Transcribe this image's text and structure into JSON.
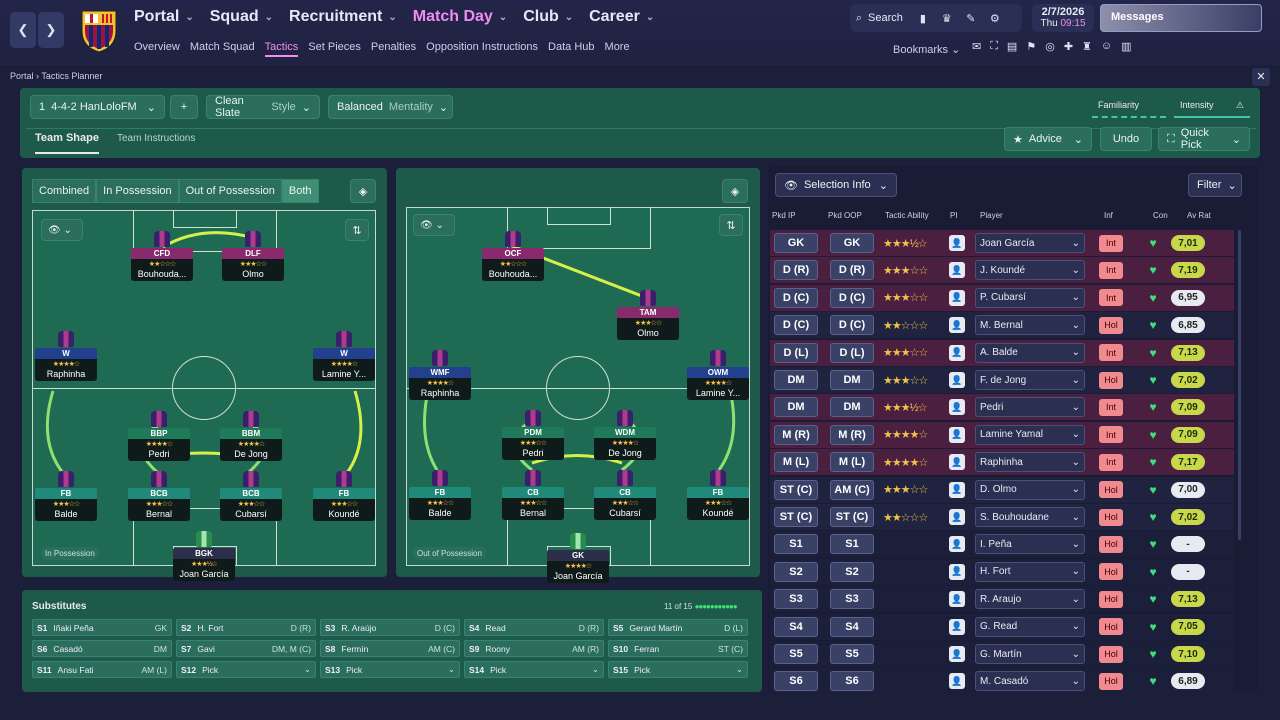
{
  "topbar": {
    "nav": [
      "Portal",
      "Squad",
      "Recruitment",
      "Match Day",
      "Club",
      "Career"
    ],
    "subnav": [
      "Overview",
      "Match Squad",
      "Tactics",
      "Set Pieces",
      "Penalties",
      "Opposition Instructions",
      "Data Hub",
      "More"
    ],
    "search": "Search",
    "bookmarks": "Bookmarks",
    "date": "2/7/2026",
    "day": "Thu",
    "time": "09:15",
    "messages": "Messages"
  },
  "breadcrumb": {
    "root": "Portal",
    "page": "Tactics Planner"
  },
  "tactic": {
    "index": "1",
    "name": "4-4-2 HanLoloFM",
    "style_value": "Clean Slate",
    "style_label": "Style",
    "mentality_value": "Balanced",
    "mentality_label": "Mentality",
    "familiarity": "Familiarity",
    "intensity": "Intensity",
    "tabs": [
      "Team Shape",
      "Team Instructions"
    ],
    "advice": "Advice",
    "undo": "Undo",
    "quickpick": "Quick Pick"
  },
  "phase_toggle": [
    "Combined",
    "In Possession",
    "Out of Possession",
    "Both"
  ],
  "pitch_in": {
    "label": "In Possession",
    "players": [
      {
        "role": "CFD",
        "name": "Bouhouda...",
        "stars": "★★☆☆☆",
        "color": "#8a2a6e"
      },
      {
        "role": "DLF",
        "name": "Olmo",
        "stars": "★★★☆☆",
        "color": "#8a2a6e"
      },
      {
        "role": "W",
        "name": "Raphinha",
        "stars": "★★★★☆",
        "color": "#23408f"
      },
      {
        "role": "W",
        "name": "Lamine Y...",
        "stars": "★★★★☆",
        "color": "#23408f"
      },
      {
        "role": "BBP",
        "name": "Pedri",
        "stars": "★★★★☆",
        "color": "#1f7a5a"
      },
      {
        "role": "BBM",
        "name": "De Jong",
        "stars": "★★★★☆",
        "color": "#1f7a5a"
      },
      {
        "role": "FB",
        "name": "Balde",
        "stars": "★★★☆☆",
        "color": "#1f8a7a"
      },
      {
        "role": "BCB",
        "name": "Bernal",
        "stars": "★★★☆☆",
        "color": "#1f8a7a"
      },
      {
        "role": "BCB",
        "name": "Cubarsí",
        "stars": "★★★☆☆",
        "color": "#1f8a7a"
      },
      {
        "role": "FB",
        "name": "Koundé",
        "stars": "★★★☆☆",
        "color": "#1f8a7a"
      },
      {
        "role": "BGK",
        "name": "Joan García",
        "stars": "★★★½☆",
        "color": "#2d2f4a"
      }
    ]
  },
  "pitch_out": {
    "label": "Out of Possession",
    "players": [
      {
        "role": "OCF",
        "name": "Bouhouda...",
        "stars": "★★☆☆☆",
        "color": "#8a2a6e"
      },
      {
        "role": "TAM",
        "name": "Olmo",
        "stars": "★★★☆☆",
        "color": "#8a2a6e"
      },
      {
        "role": "WMF",
        "name": "Raphinha",
        "stars": "★★★★☆",
        "color": "#23408f"
      },
      {
        "role": "OWM",
        "name": "Lamine Y...",
        "stars": "★★★★☆",
        "color": "#23408f"
      },
      {
        "role": "PDM",
        "name": "Pedri",
        "stars": "★★★☆☆",
        "color": "#1f7a5a"
      },
      {
        "role": "WDM",
        "name": "De Jong",
        "stars": "★★★★☆",
        "color": "#1f7a5a"
      },
      {
        "role": "FB",
        "name": "Balde",
        "stars": "★★★☆☆",
        "color": "#1f8a7a"
      },
      {
        "role": "CB",
        "name": "Bernal",
        "stars": "★★★☆☆",
        "color": "#1f8a7a"
      },
      {
        "role": "CB",
        "name": "Cubarsí",
        "stars": "★★★☆☆",
        "color": "#1f8a7a"
      },
      {
        "role": "FB",
        "name": "Koundé",
        "stars": "★★★☆☆",
        "color": "#1f8a7a"
      },
      {
        "role": "GK",
        "name": "Joan García",
        "stars": "★★★★☆",
        "color": "#2d2f4a"
      }
    ]
  },
  "selection": {
    "title": "Selection Info",
    "filter": "Filter",
    "headers": [
      "Pkd IP",
      "Pkd OOP",
      "Tactic Ability",
      "PI",
      "Player",
      "Inf",
      "Con",
      "Av Rat"
    ],
    "rows": [
      {
        "ip": "GK",
        "oop": "GK",
        "stars": "★★★½☆",
        "player": "Joan García",
        "inf": "Int",
        "rat": "7,01",
        "bg": "#4a1f3f",
        "ratc": "#c8d84a"
      },
      {
        "ip": "D (R)",
        "oop": "D (R)",
        "stars": "★★★☆☆",
        "player": "J. Koundé",
        "inf": "Int",
        "rat": "7,19",
        "bg": "#4a1f3f",
        "ratc": "#c8d84a"
      },
      {
        "ip": "D (C)",
        "oop": "D (C)",
        "stars": "★★★☆☆",
        "player": "P. Cubarsí",
        "inf": "Int",
        "rat": "6,95",
        "bg": "#4a1f3f",
        "ratc": "#e8eaf2"
      },
      {
        "ip": "D (C)",
        "oop": "D (C)",
        "stars": "★★☆☆☆",
        "player": "M. Bernal",
        "inf": "Hol",
        "rat": "6,85",
        "bg": "#1f2340",
        "ratc": "#e8eaf2"
      },
      {
        "ip": "D (L)",
        "oop": "D (L)",
        "stars": "★★★☆☆",
        "player": "A. Balde",
        "inf": "Int",
        "rat": "7,13",
        "bg": "#4a1f3f",
        "ratc": "#c8d84a"
      },
      {
        "ip": "DM",
        "oop": "DM",
        "stars": "★★★☆☆",
        "player": "F. de Jong",
        "inf": "Hol",
        "rat": "7,02",
        "bg": "#1f2340",
        "ratc": "#c8d84a"
      },
      {
        "ip": "DM",
        "oop": "DM",
        "stars": "★★★½☆",
        "player": "Pedri",
        "inf": "Int",
        "rat": "7,09",
        "bg": "#4a1f3f",
        "ratc": "#c8d84a"
      },
      {
        "ip": "M (R)",
        "oop": "M (R)",
        "stars": "★★★★☆",
        "player": "Lamine Yamal",
        "inf": "Int",
        "rat": "7,09",
        "bg": "#4a1f3f",
        "ratc": "#c8d84a"
      },
      {
        "ip": "M (L)",
        "oop": "M (L)",
        "stars": "★★★★☆",
        "player": "Raphinha",
        "inf": "Int",
        "rat": "7,17",
        "bg": "#4a1f3f",
        "ratc": "#c8d84a"
      },
      {
        "ip": "ST (C)",
        "oop": "AM (C)",
        "stars": "★★★☆☆",
        "player": "D. Olmo",
        "inf": "Hol",
        "rat": "7,00",
        "bg": "#1f2340",
        "ratc": "#e8eaf2"
      },
      {
        "ip": "ST (C)",
        "oop": "ST (C)",
        "stars": "★★☆☆☆",
        "player": "S. Bouhoudane",
        "inf": "Hol",
        "rat": "7,02",
        "bg": "#1f2340",
        "ratc": "#c8d84a"
      },
      {
        "ip": "S1",
        "oop": "S1",
        "stars": "",
        "player": "I. Peña",
        "inf": "Hol",
        "rat": "-",
        "bg": "#1c1f3a",
        "ratc": "#e8eaf2"
      },
      {
        "ip": "S2",
        "oop": "S2",
        "stars": "",
        "player": "H. Fort",
        "inf": "Hol",
        "rat": "-",
        "bg": "#1c1f3a",
        "ratc": "#e8eaf2"
      },
      {
        "ip": "S3",
        "oop": "S3",
        "stars": "",
        "player": "R. Araujo",
        "inf": "Hol",
        "rat": "7,13",
        "bg": "#1c1f3a",
        "ratc": "#c8d84a"
      },
      {
        "ip": "S4",
        "oop": "S4",
        "stars": "",
        "player": "G. Read",
        "inf": "Hol",
        "rat": "7,05",
        "bg": "#1c1f3a",
        "ratc": "#c8d84a"
      },
      {
        "ip": "S5",
        "oop": "S5",
        "stars": "",
        "player": "G. Martín",
        "inf": "Hol",
        "rat": "7,10",
        "bg": "#1c1f3a",
        "ratc": "#c8d84a"
      },
      {
        "ip": "S6",
        "oop": "S6",
        "stars": "",
        "player": "M. Casadó",
        "inf": "Hol",
        "rat": "6,89",
        "bg": "#1c1f3a",
        "ratc": "#e8eaf2"
      }
    ]
  },
  "subs": {
    "title": "Substitutes",
    "count": "11 of 15",
    "cells": [
      {
        "slot": "S1",
        "name": "Iñaki Peña",
        "pos": "GK"
      },
      {
        "slot": "S2",
        "name": "H. Fort",
        "pos": "D (R)"
      },
      {
        "slot": "S3",
        "name": "R. Araújo",
        "pos": "D (C)"
      },
      {
        "slot": "S4",
        "name": "Read",
        "pos": "D (R)"
      },
      {
        "slot": "S5",
        "name": "Gerard Martín",
        "pos": "D (L)"
      },
      {
        "slot": "S6",
        "name": "Casadó",
        "pos": "DM"
      },
      {
        "slot": "S7",
        "name": "Gavi",
        "pos": "DM, M (C)"
      },
      {
        "slot": "S8",
        "name": "Fermín",
        "pos": "AM (C)"
      },
      {
        "slot": "S9",
        "name": "Roony",
        "pos": "AM (R)"
      },
      {
        "slot": "S10",
        "name": "Ferran",
        "pos": "ST (C)"
      },
      {
        "slot": "S11",
        "name": "Ansu Fati",
        "pos": "AM (L)"
      },
      {
        "slot": "S12",
        "name": "Pick",
        "pos": "⌄"
      },
      {
        "slot": "S13",
        "name": "Pick",
        "pos": "⌄"
      },
      {
        "slot": "S14",
        "name": "Pick",
        "pos": "⌄"
      },
      {
        "slot": "S15",
        "name": "Pick",
        "pos": "⌄"
      }
    ]
  }
}
